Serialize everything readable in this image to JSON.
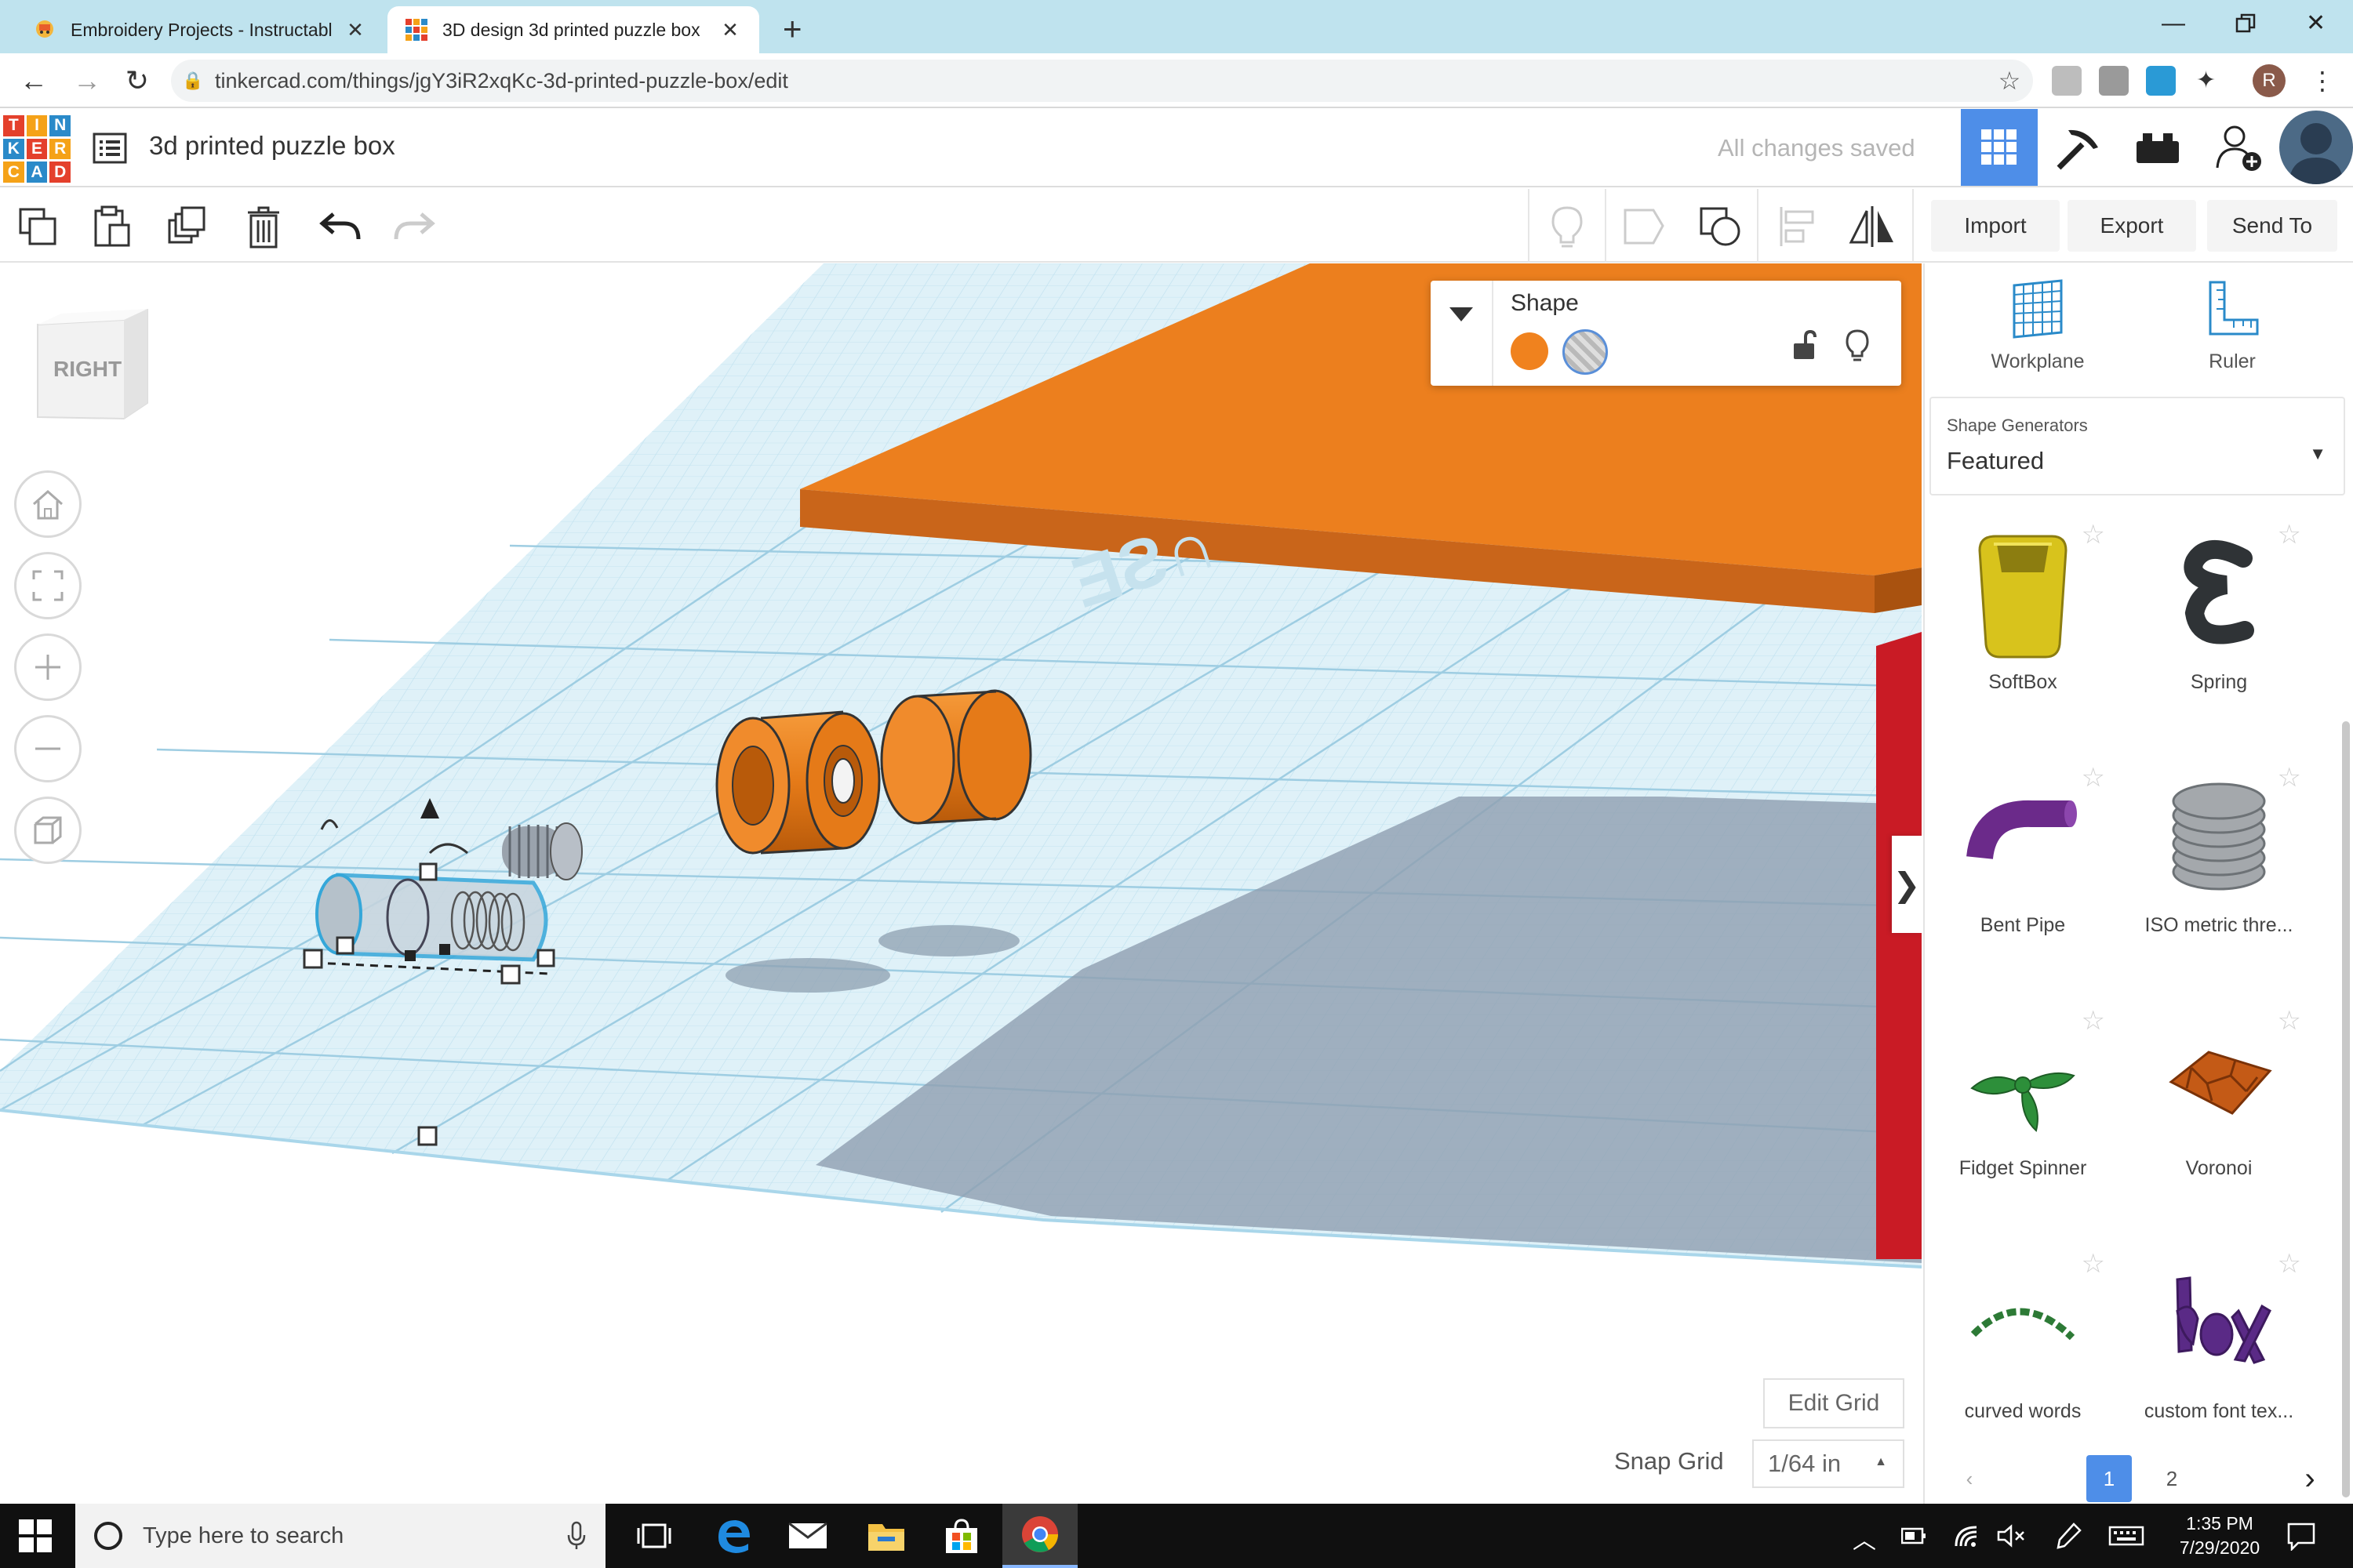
{
  "browser": {
    "tabs": [
      {
        "title": "Embroidery Projects - Instructabl",
        "active": false
      },
      {
        "title": "3D design 3d printed puzzle box",
        "active": true
      }
    ],
    "new_tab": "+",
    "url": "tinkercad.com/things/jgY3iR2xqKc-3d-printed-puzzle-box/edit",
    "profile_initial": "R"
  },
  "app": {
    "logo_letters": [
      "T",
      "I",
      "N",
      "K",
      "E",
      "R",
      "C",
      "A",
      "D"
    ],
    "logo_colors": [
      "#e4402c",
      "#f5a218",
      "#2a8ac9",
      "#2a8ac9",
      "#e4402c",
      "#f5a218",
      "#f5a218",
      "#2a8ac9",
      "#e4402c"
    ],
    "design_title": "3d printed puzzle box",
    "save_status": "All changes saved"
  },
  "toolbar": {
    "import": "Import",
    "export": "Export",
    "send_to": "Send To"
  },
  "workspace": {
    "viewcube_face": "RIGHT",
    "shape_panel": {
      "title": "Shape",
      "solid_color": "#f0821e"
    },
    "edit_grid": "Edit Grid",
    "snap_grid_label": "Snap Grid",
    "snap_grid_value": "1/64 in",
    "panel_toggle": "❯"
  },
  "right_panel": {
    "tools": [
      {
        "label": "Workplane",
        "icon": "workplane-icon"
      },
      {
        "label": "Ruler",
        "icon": "ruler-icon"
      }
    ],
    "shape_generators_label": "Shape Generators",
    "shape_generators_value": "Featured",
    "shapes": [
      {
        "label": "SoftBox",
        "icon": "softbox-icon"
      },
      {
        "label": "Spring",
        "icon": "spring-icon"
      },
      {
        "label": "Bent Pipe",
        "icon": "bent-pipe-icon"
      },
      {
        "label": "ISO metric thre...",
        "icon": "iso-thread-icon"
      },
      {
        "label": "Fidget Spinner",
        "icon": "fidget-spinner-icon"
      },
      {
        "label": "Voronoi",
        "icon": "voronoi-icon"
      },
      {
        "label": "curved words",
        "icon": "curved-words-icon"
      },
      {
        "label": "custom font tex...",
        "icon": "custom-font-icon"
      }
    ],
    "pager": {
      "prev": "‹",
      "pages": [
        "1",
        "2"
      ],
      "current": "1",
      "next": "›"
    }
  },
  "taskbar": {
    "search_placeholder": "Type here to search",
    "time": "1:35 PM",
    "date": "7/29/2020"
  }
}
